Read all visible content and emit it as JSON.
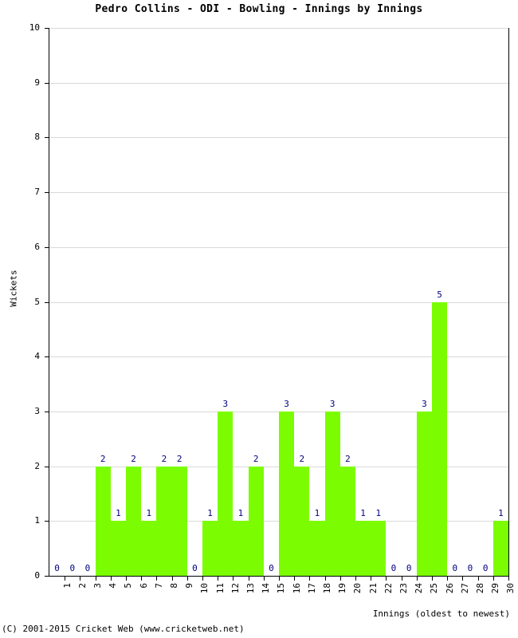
{
  "chart_data": {
    "type": "bar",
    "title": "Pedro Collins - ODI - Bowling - Innings by Innings",
    "xlabel": "Innings (oldest to newest)",
    "ylabel": "Wickets",
    "categories": [
      "1",
      "2",
      "3",
      "4",
      "5",
      "6",
      "7",
      "8",
      "9",
      "10",
      "11",
      "12",
      "13",
      "14",
      "15",
      "16",
      "17",
      "18",
      "19",
      "20",
      "21",
      "22",
      "23",
      "24",
      "25",
      "26",
      "27",
      "28",
      "29",
      "30"
    ],
    "values": [
      0,
      0,
      0,
      2,
      1,
      2,
      1,
      2,
      2,
      0,
      1,
      3,
      1,
      2,
      0,
      3,
      2,
      1,
      3,
      2,
      1,
      1,
      0,
      0,
      3,
      5,
      0,
      0,
      0,
      1
    ],
    "value_labels": [
      "0",
      "0",
      "0",
      "2",
      "1",
      "2",
      "1",
      "2",
      "2",
      "0",
      "1",
      "3",
      "1",
      "2",
      "0",
      "3",
      "2",
      "1",
      "3",
      "2",
      "1",
      "1",
      "0",
      "0",
      "3",
      "5",
      "0",
      "0",
      "0",
      "1"
    ],
    "ylim": [
      0,
      10
    ],
    "y_ticks": [
      "0",
      "1",
      "2",
      "3",
      "4",
      "5",
      "6",
      "7",
      "8",
      "9",
      "10"
    ],
    "grid": true,
    "legend": false,
    "bar_color": "#7CFC00",
    "value_label_color": "#000080",
    "axis_color": "#000000",
    "grid_color": "#D9D9D9",
    "background": "#FFFFFF"
  },
  "footer": {
    "copyright": "(C) 2001-2015 Cricket Web (www.cricketweb.net)"
  }
}
